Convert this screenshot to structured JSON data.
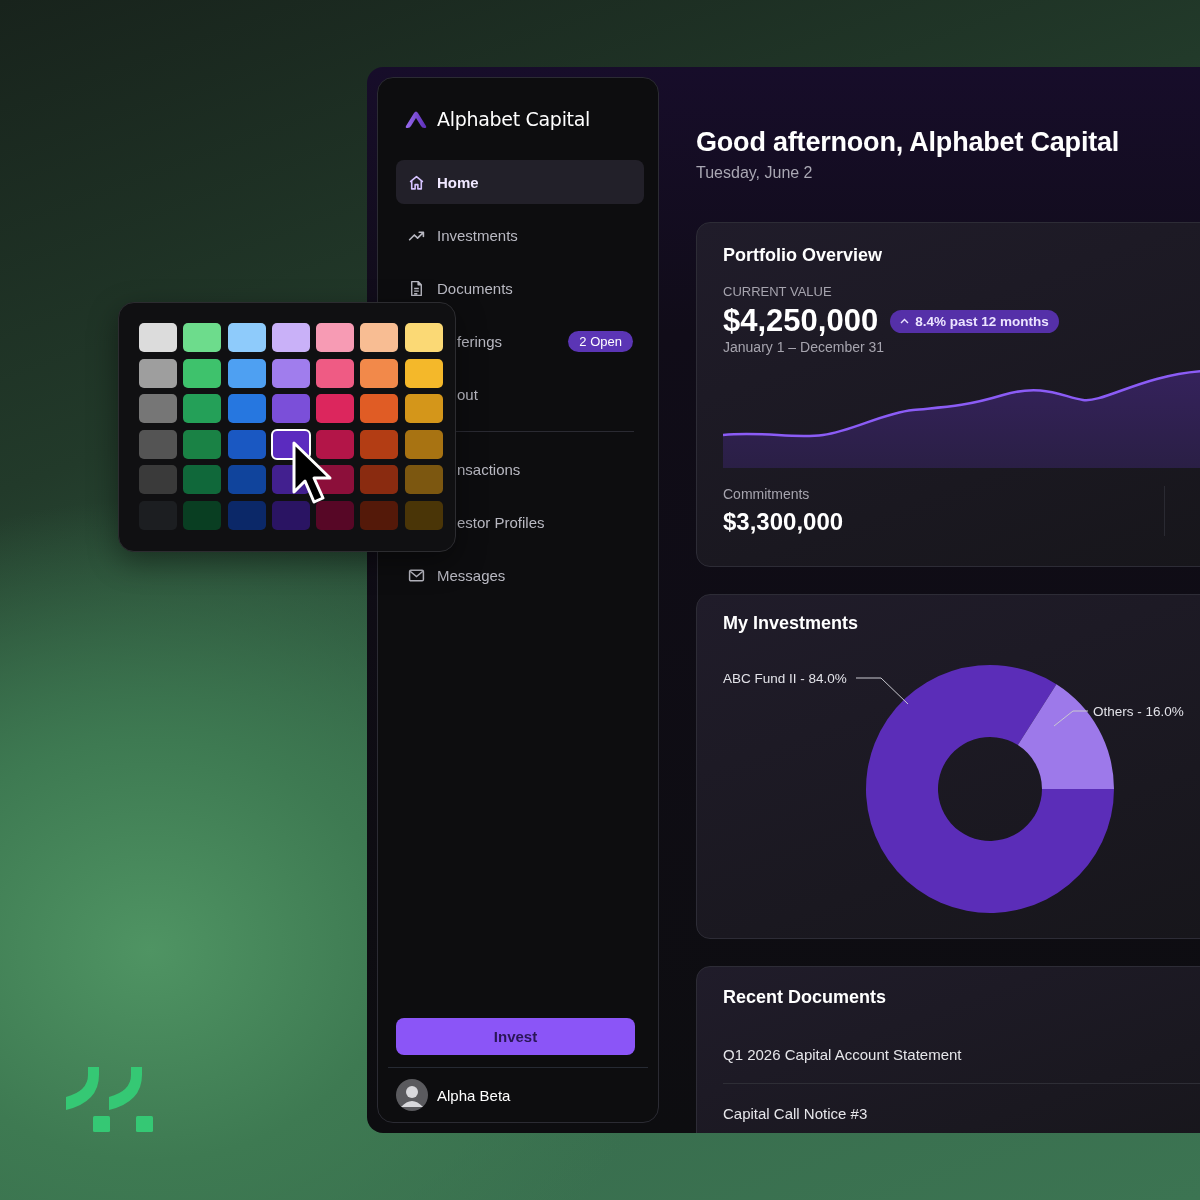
{
  "sidebar": {
    "brand": "Alphabet Capital",
    "nav": [
      {
        "label": "Home",
        "selected": true
      },
      {
        "label": "Investments",
        "selected": false
      },
      {
        "label": "Documents",
        "selected": false
      },
      {
        "label": "ferings",
        "badge": "2 Open",
        "selected": false
      },
      {
        "label": "out",
        "selected": false
      },
      {
        "label": "nsactions",
        "selected": false
      },
      {
        "label": "estor Profiles",
        "selected": false
      },
      {
        "label": "Messages",
        "selected": false
      }
    ],
    "invest_button": "Invest",
    "user": {
      "name": "Alpha Beta"
    }
  },
  "color_picker": {
    "rows": [
      [
        {
          "color": "#dcdcdc",
          "selected": false
        },
        {
          "color": "#6ddc8c",
          "selected": false
        },
        {
          "color": "#8ecbfb",
          "selected": false
        },
        {
          "color": "#c9b1f8",
          "selected": false
        },
        {
          "color": "#f79bb4",
          "selected": false
        },
        {
          "color": "#f8bd93",
          "selected": false
        },
        {
          "color": "#fbd975",
          "selected": false
        }
      ],
      [
        {
          "color": "#9e9e9e",
          "selected": false
        },
        {
          "color": "#3ec26c",
          "selected": false
        },
        {
          "color": "#4ea0f2",
          "selected": false
        },
        {
          "color": "#a07ded",
          "selected": false
        },
        {
          "color": "#ef5b84",
          "selected": false
        },
        {
          "color": "#f2894a",
          "selected": false
        },
        {
          "color": "#f4b82a",
          "selected": false
        }
      ],
      [
        {
          "color": "#767676",
          "selected": false
        },
        {
          "color": "#24a058",
          "selected": false
        },
        {
          "color": "#2677e0",
          "selected": false
        },
        {
          "color": "#7b4fd9",
          "selected": false
        },
        {
          "color": "#dc265d",
          "selected": false
        },
        {
          "color": "#e05c25",
          "selected": false
        },
        {
          "color": "#d4961a",
          "selected": false
        }
      ],
      [
        {
          "color": "#545454",
          "selected": false
        },
        {
          "color": "#1a8245",
          "selected": false
        },
        {
          "color": "#1a58c2",
          "selected": false
        },
        {
          "color": "#5b2bbf",
          "selected": true
        },
        {
          "color": "#b31548",
          "selected": false
        },
        {
          "color": "#b33d14",
          "selected": false
        },
        {
          "color": "#a87312",
          "selected": false
        }
      ],
      [
        {
          "color": "#3a3a3a",
          "selected": false
        },
        {
          "color": "#10683a",
          "selected": false
        },
        {
          "color": "#10449c",
          "selected": false
        },
        {
          "color": "#42208f",
          "selected": false
        },
        {
          "color": "#8c0f3a",
          "selected": false
        },
        {
          "color": "#8a2b10",
          "selected": false
        },
        {
          "color": "#7c5710",
          "selected": false
        }
      ],
      [
        {
          "color": "#1c1e21",
          "selected": false
        },
        {
          "color": "#093e22",
          "selected": false
        },
        {
          "color": "#0b2868",
          "selected": false
        },
        {
          "color": "#2a1463",
          "selected": false
        },
        {
          "color": "#570726",
          "selected": false
        },
        {
          "color": "#541909",
          "selected": false
        },
        {
          "color": "#4a3507",
          "selected": false
        }
      ]
    ]
  },
  "header": {
    "greeting": "Good afternoon, Alphabet Capital",
    "date": "Tuesday, June 2"
  },
  "portfolio": {
    "title": "Portfolio Overview",
    "current_value_label": "CURRENT VALUE",
    "current_value": "$4,250,000",
    "change": "8.4% past 12 months",
    "period": "January 1 – December 31",
    "commitments_label": "Commitments",
    "commitments": "$3,300,000"
  },
  "investments": {
    "title": "My Investments",
    "label_separator": "-",
    "chart_data": {
      "type": "donut",
      "categories": [
        "ABC Fund II",
        "Others"
      ],
      "values": [
        84.0,
        16.0
      ],
      "value_labels": [
        "84.0%",
        "16.0%"
      ]
    }
  },
  "documents": {
    "title": "Recent Documents",
    "items": [
      "Q1 2026 Capital Account Statement",
      "Capital Call Notice #3"
    ]
  }
}
